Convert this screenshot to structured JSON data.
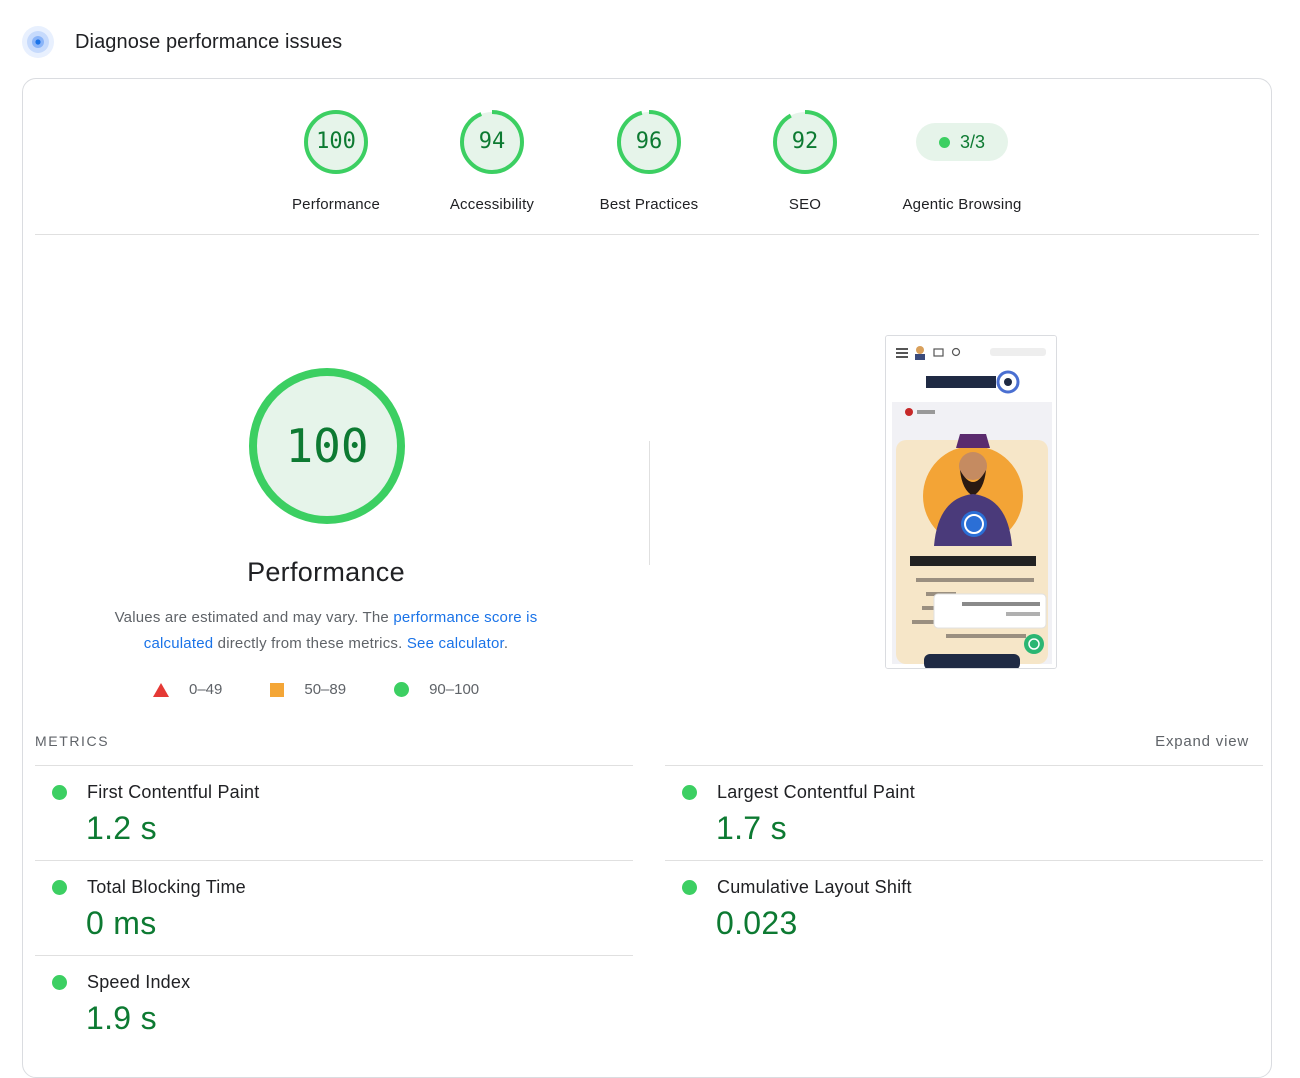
{
  "header": {
    "title": "Diagnose performance issues",
    "icon": "lighthouse-icon"
  },
  "gauges": [
    {
      "score": "100",
      "label": "Performance",
      "value": 100
    },
    {
      "score": "94",
      "label": "Accessibility",
      "value": 94
    },
    {
      "score": "96",
      "label": "Best Practices",
      "value": 96
    },
    {
      "score": "92",
      "label": "SEO",
      "value": 92
    }
  ],
  "agentic": {
    "score": "3/3",
    "label": "Agentic Browsing"
  },
  "performance": {
    "score": "100",
    "title": "Performance",
    "desc_prefix": "Values are estimated and may vary. The ",
    "desc_link1": "performance score is calculated",
    "desc_middle": " directly from these metrics. ",
    "desc_link2": "See calculator",
    "desc_suffix": "."
  },
  "legend": {
    "fail": "0–49",
    "average": "50–89",
    "pass": "90–100"
  },
  "colors": {
    "pass": "#0d7a32",
    "pass_dot": "#3ccf62",
    "average": "#f4a637",
    "fail": "#e53935",
    "link": "#1a73e8"
  },
  "metrics": {
    "heading": "METRICS",
    "expand": "Expand view",
    "items": [
      {
        "name": "First Contentful Paint",
        "value": "1.2 s"
      },
      {
        "name": "Largest Contentful Paint",
        "value": "1.7 s"
      },
      {
        "name": "Total Blocking Time",
        "value": "0 ms"
      },
      {
        "name": "Cumulative Layout Shift",
        "value": "0.023"
      },
      {
        "name": "Speed Index",
        "value": "1.9 s"
      }
    ]
  },
  "screenshot": {
    "language": "English",
    "heading": "وردپرس فارسی به زبان ساده"
  }
}
